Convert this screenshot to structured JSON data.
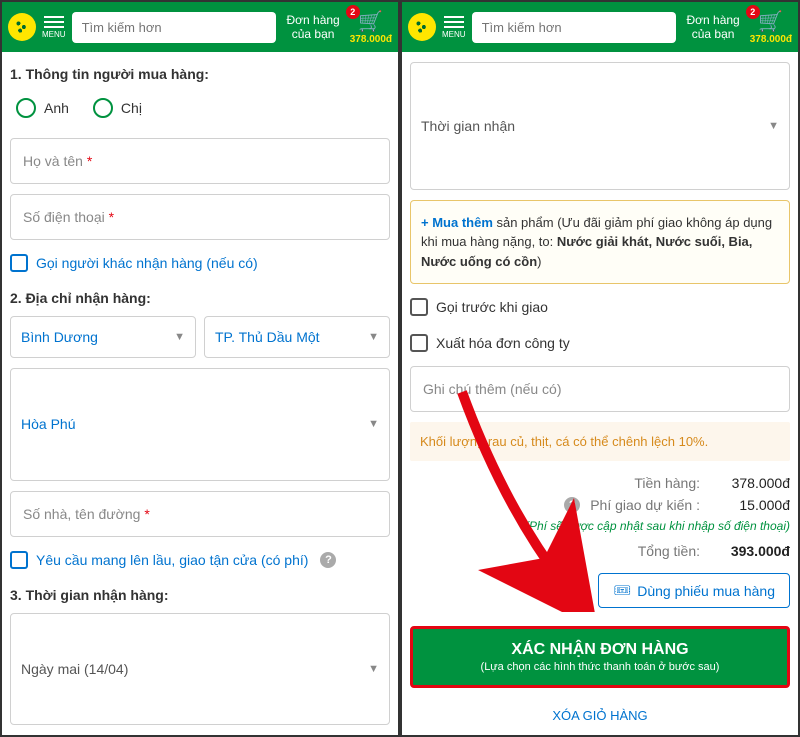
{
  "header": {
    "menu_label": "MENU",
    "search_placeholder": "Tìm kiếm hơn",
    "order_link_l1": "Đơn hàng",
    "order_link_l2": "của bạn",
    "cart_badge": "2",
    "cart_total": "378.000đ"
  },
  "left": {
    "sec1_title": "1. Thông tin người mua hàng:",
    "gender_anh": "Anh",
    "gender_chi": "Chị",
    "name_ph": "Họ và tên ",
    "phone_ph": "Số điện thoại ",
    "req": "*",
    "other_receiver": "Gọi người khác nhận hàng (nếu có)",
    "sec2_title": "2. Địa chỉ nhận hàng:",
    "province": "Bình Dương",
    "city": "TP. Thủ Dầu Một",
    "ward": "Hòa Phú",
    "street_ph": "Số nhà, tên đường ",
    "floor_service": "Yêu cầu mang lên lầu, giao tận cửa (có phí)",
    "sec3_title": "3. Thời gian nhận hàng:",
    "date_select": "Ngày mai (14/04)"
  },
  "right": {
    "time_select": "Thời gian nhận",
    "promo_plus": "+ Mua thêm",
    "promo_mid": " sản phẩm (Ưu đãi giảm phí giao không áp dụng khi mua hàng nặng, to: ",
    "promo_bold": "Nước giải khát, Nước suối, Bia, Nước uống có cồn",
    "promo_close": ")",
    "call_before": "Gọi trước khi giao",
    "company_invoice": "Xuất hóa đơn công ty",
    "note_ph": "Ghi chú thêm (nếu có)",
    "weight_note": "Khối lượng rau củ, thịt, cá có thể chênh lệch 10%.",
    "sum_goods_label": "Tiền hàng:",
    "sum_goods_val": "378.000đ",
    "sum_ship_label": "Phí giao dự kiến :",
    "sum_ship_val": "15.000đ",
    "sum_ship_note": "(Phí sẽ được cập nhật sau khi nhập số điện thoại)",
    "sum_total_label": "Tổng tiền:",
    "sum_total_val": "393.000đ",
    "voucher_label": "Dùng phiếu mua hàng",
    "confirm_main": "XÁC NHẬN ĐƠN HÀNG",
    "confirm_sub": "(Lựa chọn các hình thức thanh toán ở bước sau)",
    "clear_cart": "XÓA GIỎ HÀNG"
  }
}
